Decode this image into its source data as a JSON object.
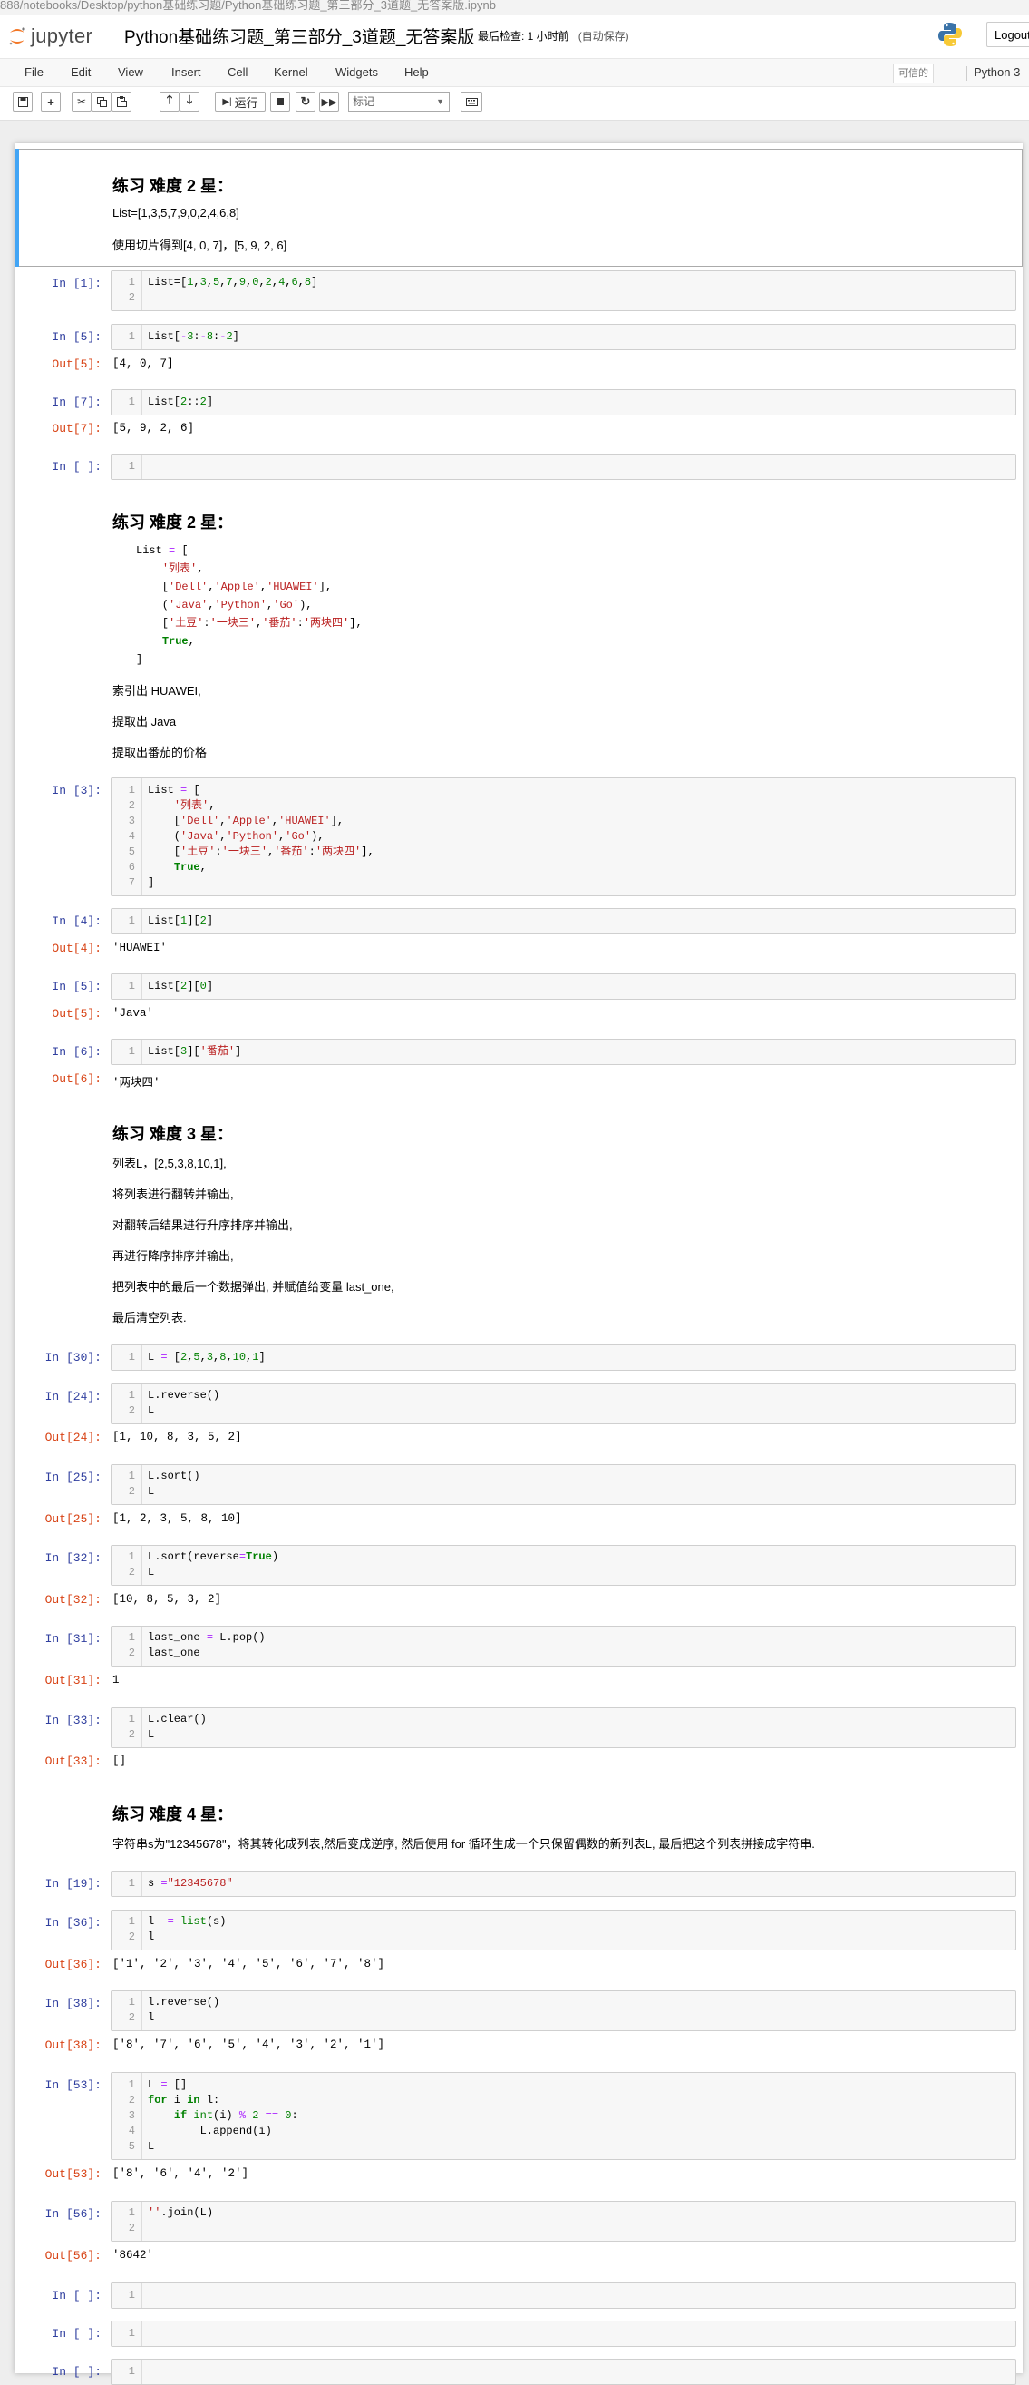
{
  "browser": {
    "url": "888/notebooks/Desktop/python基础练习题/Python基础练习题_第三部分_3道题_无答案版.ipynb"
  },
  "header": {
    "logo_text": "jupyter",
    "notebook_title": "Python基础练习题_第三部分_3道题_无答案版",
    "checkpoint": "最后检查: 1 小时前",
    "autosave": "(自动保存)",
    "logout": "Logout"
  },
  "menu": {
    "items": [
      "File",
      "Edit",
      "View",
      "Insert",
      "Cell",
      "Kernel",
      "Widgets",
      "Help"
    ],
    "trusted": "可信的",
    "kernel": "Python 3"
  },
  "toolbar": {
    "run_label": "运行",
    "cell_type": "标记"
  },
  "cells": {
    "md1": {
      "title": "练习 难度 2 星：",
      "line1": "List=[1,3,5,7,9,0,2,4,6,8]",
      "line2": "使用切片得到[4, 0, 7]，[5, 9, 2, 6]"
    },
    "c1": {
      "prompt": "In  [1]:"
    },
    "c2": {
      "prompt": "In  [5]:",
      "out_prompt": "Out[5]:",
      "output": "[4, 0, 7]"
    },
    "c3": {
      "prompt": "In  [7]:",
      "out_prompt": "Out[7]:",
      "output": "[5, 9, 2, 6]"
    },
    "c4": {
      "prompt": "In  [ ]:"
    },
    "md2": {
      "title": "练习 难度 2 星：",
      "p1": "索引出 HUAWEI,",
      "p2": "提取出 Java",
      "p3": "提取出番茄的价格"
    },
    "c5": {
      "prompt": "In  [3]:"
    },
    "c6": {
      "prompt": "In  [4]:",
      "out_prompt": "Out[4]:",
      "output": "'HUAWEI'"
    },
    "c7": {
      "prompt": "In  [5]:",
      "out_prompt": "Out[5]:",
      "output": "'Java'"
    },
    "c8": {
      "prompt": "In  [6]:",
      "out_prompt": "Out[6]:",
      "output": "'两块四'"
    },
    "md3": {
      "title": "练习 难度 3 星：",
      "p1": "列表L，[2,5,3,8,10,1],",
      "p2": "将列表进行翻转并输出,",
      "p3": "对翻转后结果进行升序排序并输出,",
      "p4": "再进行降序排序并输出,",
      "p5": "把列表中的最后一个数据弹出, 并赋值给变量 last_one,",
      "p6": "最后清空列表."
    },
    "c9": {
      "prompt": "In [30]:"
    },
    "c10": {
      "prompt": "In [24]:",
      "out_prompt": "Out[24]:",
      "output": "[1, 10, 8, 3, 5, 2]"
    },
    "c11": {
      "prompt": "In [25]:",
      "out_prompt": "Out[25]:",
      "output": "[1, 2, 3, 5, 8, 10]"
    },
    "c12": {
      "prompt": "In [32]:",
      "out_prompt": "Out[32]:",
      "output": "[10, 8, 5, 3, 2]"
    },
    "c13": {
      "prompt": "In [31]:",
      "out_prompt": "Out[31]:",
      "output": "1"
    },
    "c14": {
      "prompt": "In [33]:",
      "out_prompt": "Out[33]:",
      "output": "[]"
    },
    "md4": {
      "title": "练习 难度 4 星：",
      "p1": "字符串s为\"12345678\"，将其转化成列表,然后变成逆序, 然后使用 for 循环生成一个只保留偶数的新列表L, 最后把这个列表拼接成字符串."
    },
    "c15": {
      "prompt": "In [19]:"
    },
    "c16": {
      "prompt": "In [36]:",
      "out_prompt": "Out[36]:",
      "output": "['1', '2', '3', '4', '5', '6', '7', '8']"
    },
    "c17": {
      "prompt": "In [38]:",
      "out_prompt": "Out[38]:",
      "output": "['8', '7', '6', '5', '4', '3', '2', '1']"
    },
    "c18": {
      "prompt": "In [53]:",
      "out_prompt": "Out[53]:",
      "output": "['8', '6', '4', '2']"
    },
    "c19": {
      "prompt": "In [56]:",
      "out_prompt": "Out[56]:",
      "output": "'8642'"
    },
    "c20": {
      "prompt": "In  [ ]:"
    },
    "c21": {
      "prompt": "In  [ ]:"
    },
    "c22": {
      "prompt": "In  [ ]:"
    }
  },
  "colors": {
    "selected_cell_bar": "#42a5f5",
    "in_prompt": "#303f9f",
    "out_prompt": "#d84315",
    "keyword": "#008000",
    "string": "#ba2121",
    "operator": "#aa22ff"
  }
}
